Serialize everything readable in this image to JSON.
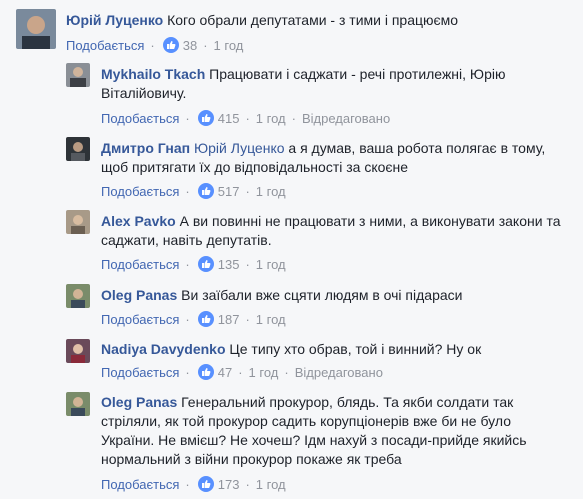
{
  "comments": [
    {
      "name": "Юрій Луценко",
      "tag": "",
      "text": "Кого обрали депутатами - з тими і працюємо",
      "like": "Подобається",
      "count": "38",
      "time": "1 год",
      "edited": ""
    },
    {
      "name": "Mykhailo Tkach",
      "tag": "",
      "text": "Працювати і саджати - речі протилежні, Юрію Віталійовичу.",
      "like": "Подобається",
      "count": "415",
      "time": "1 год",
      "edited": "Відредаговано"
    },
    {
      "name": "Дмитро Гнап",
      "tag": "Юрій Луценко",
      "text": "а я думав, ваша робота полягає в тому, щоб притягати їх до відповідальності за скоєне",
      "like": "Подобається",
      "count": "517",
      "time": "1 год",
      "edited": ""
    },
    {
      "name": "Alex Pavko",
      "tag": "",
      "text": "А ви повинні не працювати з ними, а виконувати закони та саджати, навіть депутатів.",
      "like": "Подобається",
      "count": "135",
      "time": "1 год",
      "edited": ""
    },
    {
      "name": "Oleg Panas",
      "tag": "",
      "text": "Ви заїбали вже сцяти людям в очі підараси",
      "like": "Подобається",
      "count": "187",
      "time": "1 год",
      "edited": ""
    },
    {
      "name": "Nadiya Davydenko",
      "tag": "",
      "text": "Це типу хто обрав, той і винний? Ну ок",
      "like": "Подобається",
      "count": "47",
      "time": "1 год",
      "edited": "Відредаговано"
    },
    {
      "name": "Oleg Panas",
      "tag": "",
      "text": "Генеральний прокурор, блядь. Та якби солдати так стріляли, як той прокурор садить корупціонерів вже би не було України. Не вмієш? Не хочеш? Ідм нахуй з посади-прийде якийсь нормальний з війни прокурор покаже як треба",
      "like": "Подобається",
      "count": "173",
      "time": "1 год",
      "edited": ""
    }
  ],
  "colors": {
    "link": "#365899",
    "like": "#4267b2",
    "meta": "#90949c",
    "bg": "#f6f7f9",
    "text": "#1d2129",
    "reaction": "#5890ff"
  },
  "icons": {
    "reaction": "thumbs-up-icon"
  }
}
